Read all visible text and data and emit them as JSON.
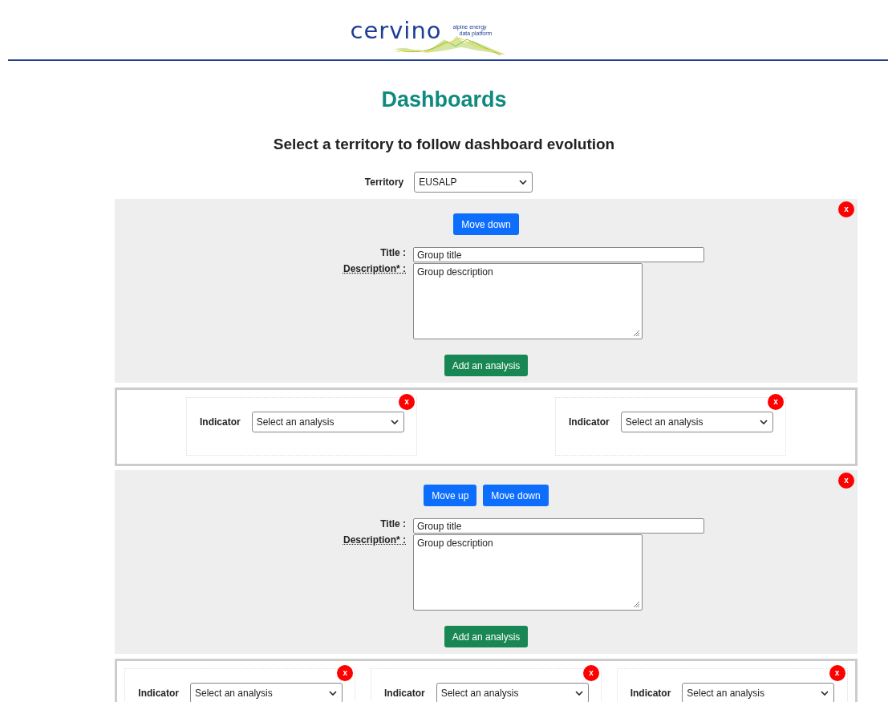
{
  "logo": {
    "name": "cervino",
    "tagline": [
      "alpine energy",
      "data platform"
    ]
  },
  "heading": "Dashboards",
  "subheading": "Select a territory to follow dashboard evolution",
  "territory": {
    "label": "Territory",
    "value": "EUSALP"
  },
  "groups": [
    {
      "remove": "x",
      "moves": [
        "Move down"
      ],
      "title_label": "Title :",
      "title_value": "Group title",
      "description_label": "Description* :",
      "description_value": "Group description",
      "add_button": "Add an analysis",
      "analyses": [
        {
          "remove": "x",
          "label": "Indicator",
          "value": "Select an analysis"
        },
        {
          "remove": "x",
          "label": "Indicator",
          "value": "Select an analysis"
        }
      ]
    },
    {
      "remove": "x",
      "moves": [
        "Move up",
        "Move down"
      ],
      "title_label": "Title :",
      "title_value": "Group title",
      "description_label": "Description* :",
      "description_value": "Group description",
      "add_button": "Add an analysis",
      "analyses": [
        {
          "remove": "x",
          "label": "Indicator",
          "value": "Select an analysis"
        },
        {
          "remove": "x",
          "label": "Indicator",
          "value": "Select an analysis"
        },
        {
          "remove": "x",
          "label": "Indicator",
          "value": "Select an analysis"
        }
      ]
    }
  ]
}
